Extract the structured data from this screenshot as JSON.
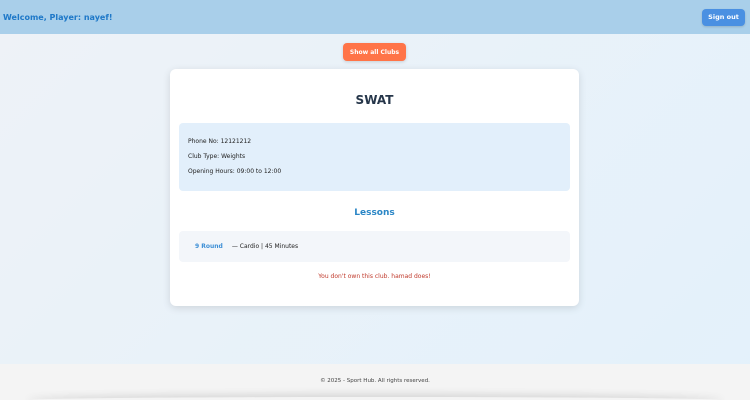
{
  "header": {
    "welcome": "Welcome, Player: nayef!",
    "signout_label": "Sign out"
  },
  "nav": {
    "show_all_label": "Show all Clubs"
  },
  "club": {
    "name": "SWAT",
    "phone": "Phone No: 12121212",
    "type": "Club Type: Weights",
    "hours": "Opening Hours: 09:00 to 12:00"
  },
  "lessons": {
    "title": "Lessons",
    "items": [
      {
        "name": "9 Round",
        "detail": "— Cardio | 45 Minutes"
      }
    ]
  },
  "ownership_message": "You don't own this club. hamad does!",
  "footer": {
    "text": "© 2025 - Sport Hub. All rights reserved."
  },
  "colors": {
    "accent": "#4a90e2",
    "show_all": "#ff7448",
    "error": "#c0392b",
    "header_bg": "#a9cfea"
  }
}
